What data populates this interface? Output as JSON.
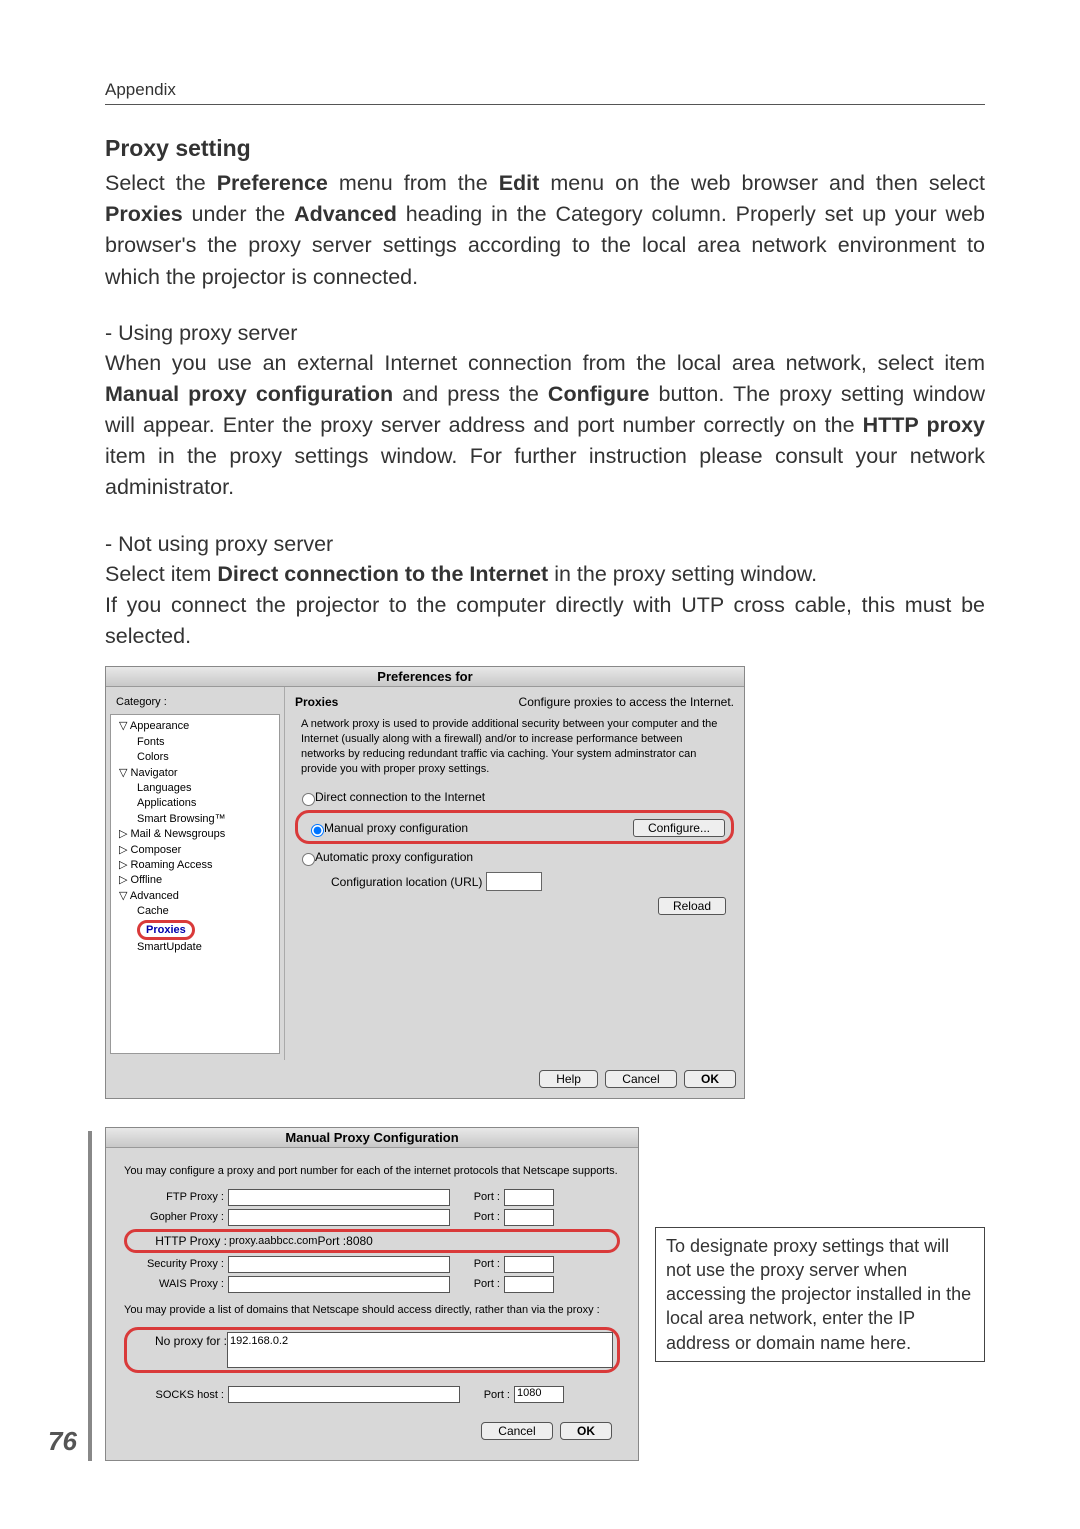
{
  "header": {
    "appendix": "Appendix"
  },
  "section": {
    "title": "Proxy setting",
    "intro_a": "Select the ",
    "intro_b": "Preference",
    "intro_c": " menu from the ",
    "intro_d": "Edit",
    "intro_e": " menu on the web browser and then select ",
    "intro_f": "Proxies",
    "intro_g": " under the ",
    "intro_h": "Advanced",
    "intro_i": " heading in the Category column. Properly set up your web browser's the proxy server settings according to the local area network environment to which the projector is connected."
  },
  "using": {
    "head": "- Using proxy server",
    "a": "When you use an external Internet connection from the local area network, select item ",
    "b": "Manual proxy configuration",
    "c": " and press the ",
    "d": "Configure",
    "e": " button. The proxy setting window will appear. Enter the proxy server address and port number correctly on the ",
    "f": "HTTP proxy",
    "g": " item in the proxy settings window. For further instruction please consult your network administrator."
  },
  "notusing": {
    "head": "- Not using proxy server",
    "a": "Select item ",
    "b": "Direct connection to the Internet",
    "c": " in the proxy setting window.",
    "d": "If you connect the projector to the computer directly with UTP cross cable, this must be selected."
  },
  "prefs": {
    "title": "Preferences for",
    "category_label": "Category :",
    "tree": {
      "appearance": "Appearance",
      "fonts": "Fonts",
      "colors": "Colors",
      "navigator": "Navigator",
      "languages": "Languages",
      "applications": "Applications",
      "smart": "Smart Browsing™",
      "mail": "Mail & Newsgroups",
      "composer": "Composer",
      "roaming": "Roaming Access",
      "offline": "Offline",
      "advanced": "Advanced",
      "cache": "Cache",
      "proxies": "Proxies",
      "smartupdate": "SmartUpdate"
    },
    "pane_title": "Proxies",
    "pane_sub": "Configure proxies to access the Internet.",
    "desc": "A network proxy is used to provide additional security between your computer and the Internet (usually along with a firewall) and/or to increase performance between networks by reducing redundant traffic via caching. Your system adminstrator can provide you with proper proxy settings.",
    "r1": "Direct connection to the Internet",
    "r2": "Manual proxy configuration",
    "r3": "Automatic proxy configuration",
    "configure": "Configure...",
    "url_label": "Configuration location (URL)",
    "reload": "Reload",
    "help": "Help",
    "cancel": "Cancel",
    "ok": "OK"
  },
  "manual": {
    "title": "Manual Proxy Configuration",
    "intro": "You may configure a proxy and port number for each of the internet protocols that Netscape supports.",
    "ftp": "FTP Proxy :",
    "gopher": "Gopher Proxy :",
    "http": "HTTP Proxy :",
    "http_val": "proxy.aabbcc.com",
    "http_port": "8080",
    "sec": "Security Proxy :",
    "wais": "WAIS Proxy :",
    "port": "Port :",
    "domains_note": "You may provide a list of domains that Netscape should access directly, rather than via the proxy :",
    "noproxy_label": "No proxy for :",
    "noproxy_val": "192.168.0.2",
    "socks": "SOCKS host :",
    "socks_port": "1080",
    "cancel": "Cancel",
    "ok": "OK"
  },
  "note": "To designate proxy settings that will not use the proxy server when accessing the projector installed in the local area network, enter the IP address or domain name here.",
  "page_number": "76"
}
